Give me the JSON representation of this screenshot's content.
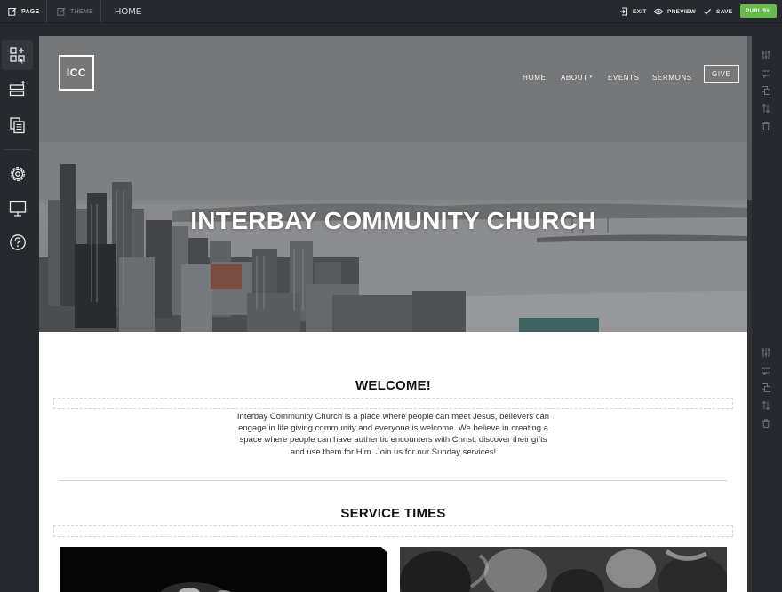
{
  "topbar": {
    "page_label": "PAGE",
    "theme_label": "THEME",
    "current_page": "HOME",
    "exit_label": "EXIT",
    "preview_label": "PREVIEW",
    "save_label": "SAVE",
    "publish_label": "PUBLISH"
  },
  "site": {
    "logo_text": "ICC",
    "nav": {
      "home": "HOME",
      "about": "ABOUT",
      "events": "EVENTS",
      "sermons": "SERMONS",
      "give": "GIVE"
    },
    "hero_title": "INTERBAY COMMUNITY CHURCH",
    "welcome_title": "WELCOME!",
    "welcome_text": "Interbay Community Church is a place where people can meet Jesus, believers can engage in life giving community and everyone is welcome. We believe in creating a space where people can have authentic encounters with Christ, discover their gifts and use them for Him. Join us for our Sunday services!",
    "service_title": "SERVICE TIMES"
  },
  "icons": {
    "left": [
      "add-element-icon",
      "add-section-icon",
      "pages-icon",
      "settings-icon",
      "desktop-icon",
      "help-icon"
    ],
    "right": [
      "adjust-icon",
      "comment-icon",
      "duplicate-icon",
      "reorder-icon",
      "delete-icon"
    ]
  },
  "colors": {
    "editor_bg": "#26292e",
    "publish": "#66bd4a",
    "canvas": "#ffffff"
  }
}
